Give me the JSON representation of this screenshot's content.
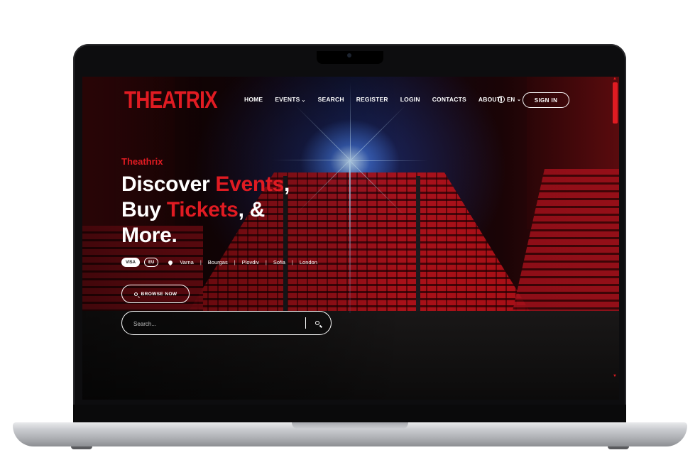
{
  "brand": {
    "logo": "THEATRIX",
    "accent_color": "#e01b22"
  },
  "nav": {
    "items": [
      {
        "label": "HOME"
      },
      {
        "label": "EVENTS",
        "has_dropdown": true
      },
      {
        "label": "SEARCH"
      },
      {
        "label": "REGISTER"
      },
      {
        "label": "LOGIN"
      },
      {
        "label": "CONTACTS"
      },
      {
        "label": "ABOUT"
      }
    ],
    "language": "EN",
    "signin_label": "SIGN IN"
  },
  "hero": {
    "eyebrow": "Theathrix",
    "line1_a": "Discover ",
    "line1_b": "Events",
    "line1_c": ",",
    "line2_a": "Buy ",
    "line2_b": "Tickets",
    "line2_c": ", &",
    "line3": "More.",
    "badges": [
      "VISA",
      "EU"
    ],
    "cities": [
      "Varna",
      "Bourgas",
      "Plovdiv",
      "Sofia",
      "London"
    ],
    "browse_label": "BROWSE NOW"
  },
  "search": {
    "placeholder": "Search..."
  },
  "icons": {
    "globe": "globe-icon",
    "pin": "location-pin-icon",
    "search": "search-icon",
    "chevron": "chevron-down-icon"
  }
}
